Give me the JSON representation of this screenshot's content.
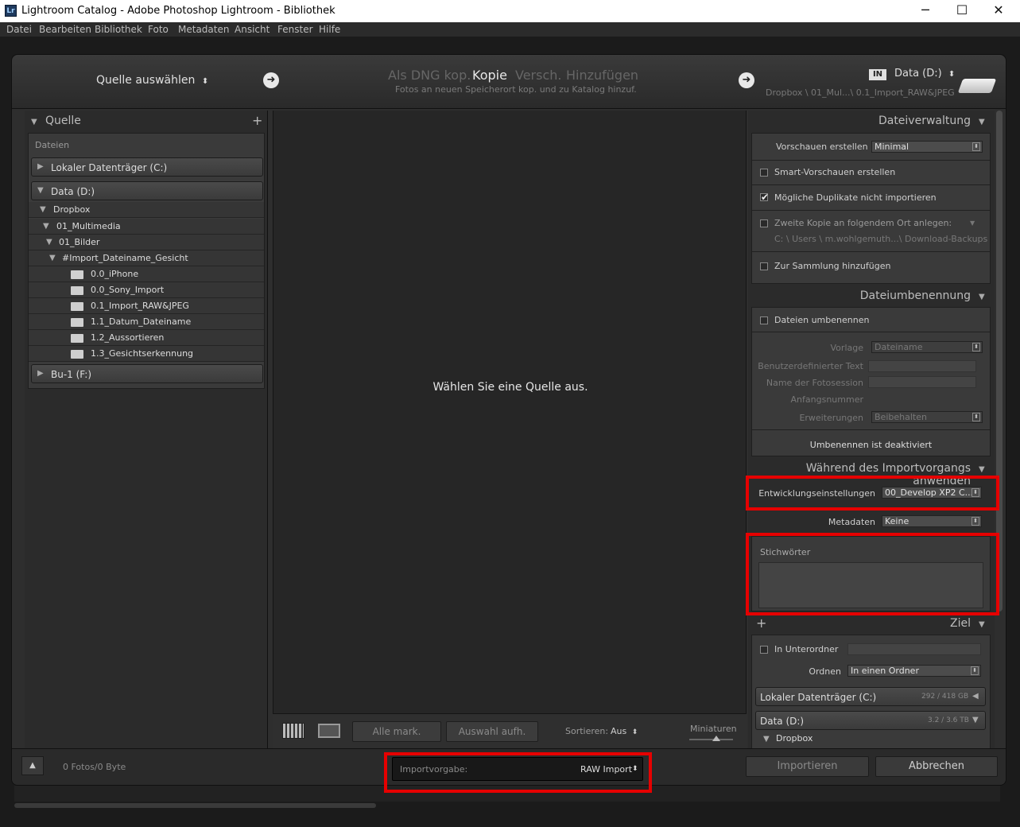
{
  "window": {
    "logo": "Lr",
    "title": "Lightroom Catalog - Adobe Photoshop Lightroom - Bibliothek",
    "minimize": "─",
    "maximize": "☐",
    "close": "✕"
  },
  "menu": [
    "Datei",
    "Bearbeiten",
    "Bibliothek",
    "Foto",
    "Metadaten",
    "Ansicht",
    "Fenster",
    "Hilfe"
  ],
  "topbar": {
    "source_label": "Quelle auswählen",
    "modes": [
      "Als DNG kop.",
      "Kopie",
      "Versch.",
      "Hinzufügen"
    ],
    "active_mode": "Kopie",
    "mode_subtitle": "Fotos an neuen Speicherort kop. und zu Katalog hinzuf.",
    "dest_badge": "IN",
    "dest_drive": "Data (D:)",
    "dest_path": "Dropbox \\ 01_Mul...\\ 0.1_Import_RAW&JPEG"
  },
  "left": {
    "header": "Quelle",
    "add": "+",
    "files_label": "Dateien",
    "drives": [
      {
        "label": "Lokaler Datenträger (C:)",
        "expanded": false
      },
      {
        "label": "Data (D:)",
        "expanded": true
      }
    ],
    "tree": [
      {
        "label": "Dropbox"
      },
      {
        "label": "01_Multimedia"
      },
      {
        "label": "01_Bilder"
      },
      {
        "label": "#Import_Dateiname_Gesicht"
      }
    ],
    "folders": [
      "0.0_iPhone",
      "0.0_Sony_Import",
      "0.1_Import_RAW&JPEG",
      "1.1_Datum_Dateiname",
      "1.2_Aussortieren",
      "1.3_Gesichtserkennung"
    ],
    "drive3": "Bu-1 (F:)",
    "status": "0 Fotos/0 Byte"
  },
  "center": {
    "message": "Wählen Sie eine Quelle aus.",
    "check_all": "Alle mark.",
    "uncheck": "Auswahl aufh.",
    "sort_label": "Sortieren:",
    "sort_value": "Aus",
    "thumbs_label": "Miniaturen"
  },
  "right": {
    "file_handling": {
      "header": "Dateiverwaltung",
      "preview_label": "Vorschauen erstellen",
      "preview_value": "Minimal",
      "smart_preview": "Smart-Vorschauen erstellen",
      "no_duplicates": "Mögliche Duplikate nicht importieren",
      "second_copy": "Zweite Kopie an folgendem Ort anlegen:",
      "second_copy_path": "C: \\ Users \\ m.wohlgemuth...\\ Download-Backups",
      "add_collection": "Zur Sammlung hinzufügen"
    },
    "rename": {
      "header": "Dateiumbenennung",
      "rename_files": "Dateien umbenennen",
      "template_label": "Vorlage",
      "template_value": "Dateiname",
      "custom_text": "Benutzerdefinierter Text",
      "session_name": "Name der Fotosession",
      "start_number": "Anfangsnummer",
      "extensions_label": "Erweiterungen",
      "extensions_value": "Beibehalten",
      "disabled_note": "Umbenennen ist deaktiviert"
    },
    "apply": {
      "header": "Während des Importvorgangs anwenden",
      "develop_label": "Entwicklungseinstellungen",
      "develop_value": "00_Develop XP2 C...",
      "metadata_label": "Metadaten",
      "metadata_value": "Keine",
      "keywords_label": "Stichwörter"
    },
    "destination": {
      "header": "Ziel",
      "subfolder": "In Unterordner",
      "organize_label": "Ordnen",
      "organize_value": "In einen Ordner",
      "drive_c": "Lokaler Datenträger (C:)",
      "drive_c_space": "292 / 418 GB",
      "drive_d": "Data (D:)",
      "drive_d_space": "3.2 / 3.6 TB",
      "dropbox": "Dropbox"
    }
  },
  "bottom": {
    "preset_label": "Importvorgabe:",
    "preset_value": "RAW Import",
    "import_button": "Importieren",
    "cancel_button": "Abbrechen"
  },
  "highlight_color": "#e60000"
}
